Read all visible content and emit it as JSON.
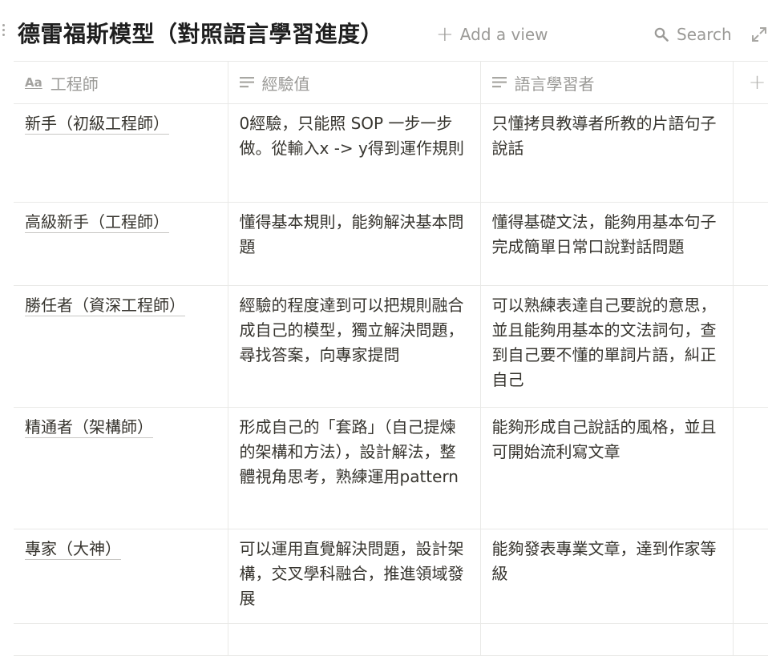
{
  "page": {
    "title": "德雷福斯模型（對照語言學習進度）",
    "add_view": "Add a view",
    "search": "Search"
  },
  "table": {
    "columns": [
      {
        "label": "工程師",
        "icon": "title-aa-icon"
      },
      {
        "label": "經驗值",
        "icon": "text-lines-icon"
      },
      {
        "label": "語言學習者",
        "icon": "text-lines-icon"
      }
    ],
    "rows": [
      {
        "name": "新手（初級工程師）",
        "exp": "0經驗，只能照 SOP 一步一步做。從輸入x -> y得到運作規則",
        "lang": "只懂拷貝教導者所教的片語句子說話"
      },
      {
        "name": "高級新手（工程師）",
        "exp": "懂得基本規則，能夠解決基本問題",
        "lang": "懂得基礎文法，能夠用基本句子完成簡單日常口說對話問題"
      },
      {
        "name": "勝任者（資深工程師）",
        "exp": "經驗的程度達到可以把規則融合成自己的模型，獨立解決問題，尋找答案，向專家提問",
        "lang": "可以熟練表達自己要說的意思，並且能夠用基本的文法詞句，查到自己要不懂的單詞片語，糾正自己"
      },
      {
        "name": "精通者（架構師）",
        "exp": "形成自己的「套路」（自己提煉的架構和方法），設計解法，整體視角思考，熟練運用pattern",
        "lang": "能夠形成自己說話的風格，並且可開始流利寫文章"
      },
      {
        "name": "專家（大神）",
        "exp": "可以運用直覺解決問題，設計架構，交叉學科融合，推進領域發展",
        "lang": "能夠發表專業文章，達到作家等級"
      }
    ]
  }
}
